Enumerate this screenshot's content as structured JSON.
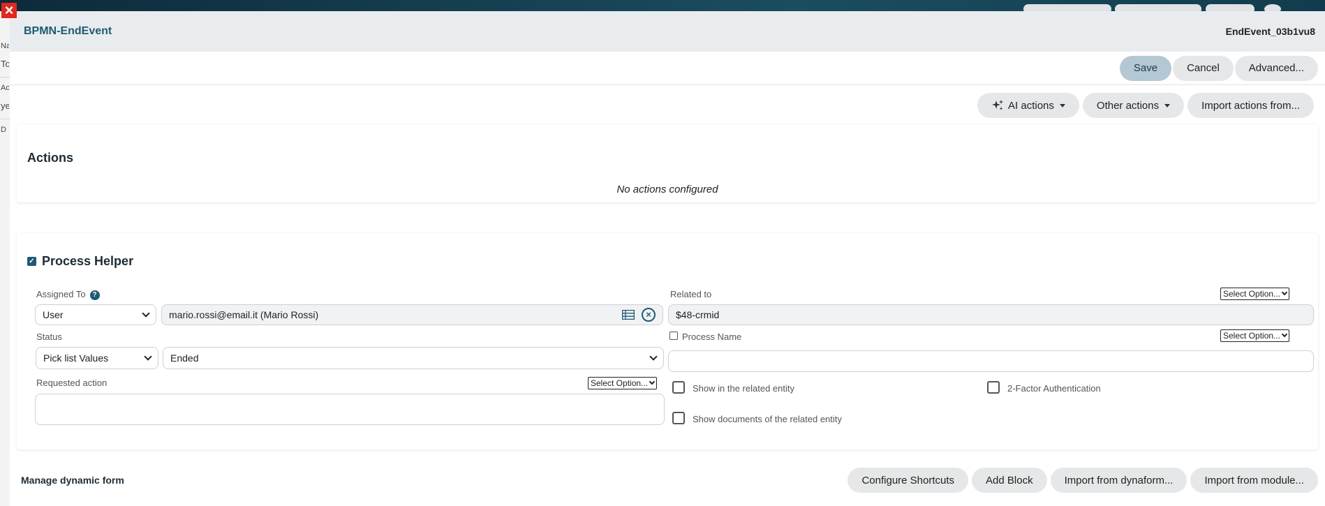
{
  "backdrop": {
    "left_texts": [
      "Na",
      "To",
      "Ac",
      "ye",
      "D"
    ]
  },
  "modal": {
    "title": "BPMN-EndEvent",
    "element_id": "EndEvent_03b1vu8"
  },
  "toolbar": {
    "save_label": "Save",
    "cancel_label": "Cancel",
    "advanced_label": "Advanced..."
  },
  "action_bar": {
    "ai_actions_label": "AI actions",
    "other_actions_label": "Other actions",
    "import_actions_label": "Import actions from..."
  },
  "actions_card": {
    "title": "Actions",
    "empty_text": "No actions configured"
  },
  "process_helper": {
    "title": "Process Helper",
    "checked": true,
    "assigned_to": {
      "label": "Assigned To",
      "type_value": "User",
      "value": "mario.rossi@email.it (Mario Rossi)"
    },
    "status": {
      "label": "Status",
      "type_value": "Pick list Values",
      "value": "Ended"
    },
    "requested_action": {
      "label": "Requested action",
      "option_label": "Select Option...",
      "value": ""
    },
    "related_to": {
      "label": "Related to",
      "option_label": "Select Option...",
      "value": "$48-crmid"
    },
    "process_name": {
      "label": "Process Name",
      "option_label": "Select Option...",
      "value": ""
    },
    "checkboxes": {
      "show_related": "Show in the related entity",
      "two_factor": "2-Factor Authentication",
      "show_documents": "Show documents of the related entity"
    }
  },
  "footer": {
    "title": "Manage dynamic form",
    "configure_shortcuts_label": "Configure Shortcuts",
    "add_block_label": "Add Block",
    "import_dynaform_label": "Import from dynaform...",
    "import_module_label": "Import from module..."
  },
  "colors": {
    "accent": "#1e5a73",
    "save_button": "#b3c8d2",
    "close_button": "#e0281f"
  }
}
